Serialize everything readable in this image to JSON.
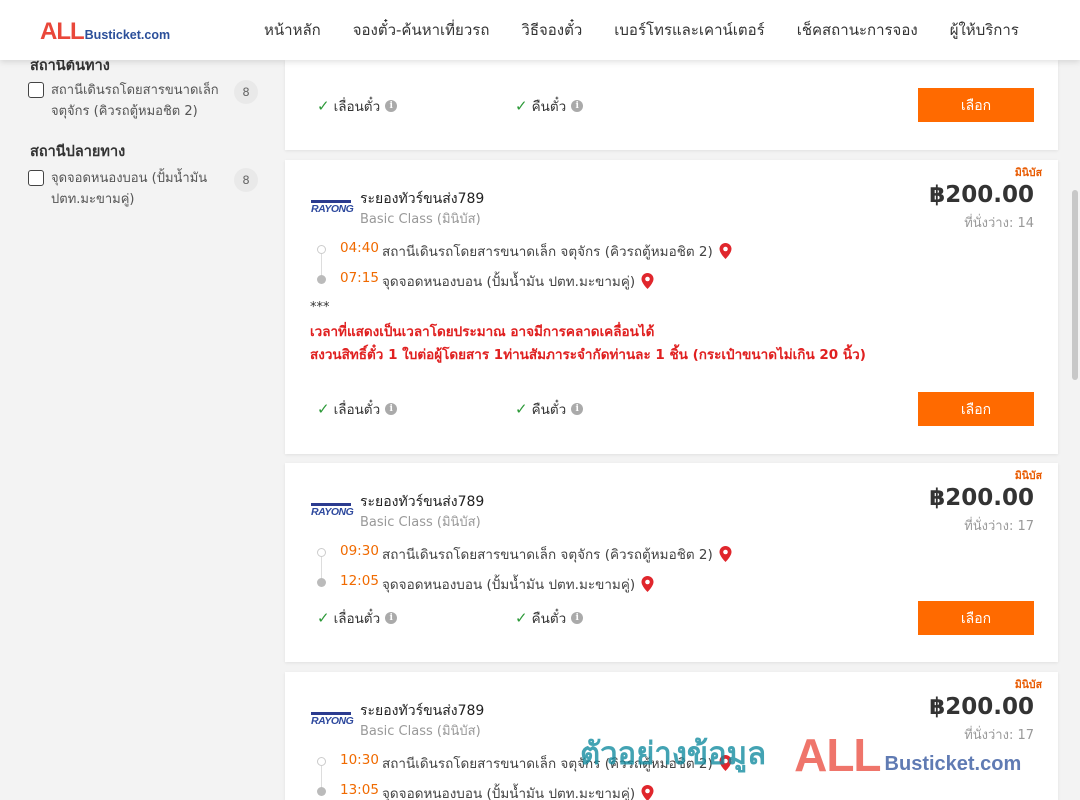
{
  "header": {
    "logo_all": "ALL",
    "logo_site": "Busticket.com",
    "nav": [
      "หน้าหลัก",
      "จองตั๋ว-ค้นหาเที่ยวรถ",
      "วิธีจองตั๋ว",
      "เบอร์โทรและเคาน์เตอร์",
      "เช็คสถานะการจอง",
      "ผู้ให้บริการ"
    ]
  },
  "sidebar": {
    "origin_title": "สถานีต้นทาง",
    "origin_filter": {
      "label": "สถานีเดินรถโดยสารขนาดเล็ก จตุจักร (คิวรถตู้หมอชิต 2)",
      "count": "8"
    },
    "dest_title": "สถานีปลายทาง",
    "dest_filter": {
      "label": "จุดจอดหนองบอน (ปั้มน้ำมัน ปตท.มะขามคู่)",
      "count": "8"
    }
  },
  "common": {
    "reschedule": "เลื่อนตั๋ว",
    "refund": "คืนตั๋ว",
    "select": "เลือก",
    "mini_tag": "มินิบัส",
    "logo_text": "RAYONG",
    "info_glyph": "i",
    "check_glyph": "✓"
  },
  "trips": [
    {
      "operator": "ระยองทัวร์ขนส่ง789",
      "class": "Basic Class (มินิบัส)",
      "price": "฿200.00",
      "seats": "ที่นั่งว่าง: 14",
      "depart_time": "04:40",
      "depart_station": "สถานีเดินรถโดยสารขนาดเล็ก จตุจักร (คิวรถตู้หมอชิต 2)",
      "arrive_time": "07:15",
      "arrive_station": "จุดจอดหนองบอน (ปั้มน้ำมัน ปตท.มะขามคู่)",
      "note_stars": "***",
      "note_line1": "เวลาที่แสดงเป็นเวลาโดยประมาณ อาจมีการคลาดเคลื่อนได้",
      "note_line2": "สงวนสิทธิ์ตั๋ว 1 ใบต่อผู้โดยสาร 1ท่านสัมภาระจำกัดท่านละ 1 ชิ้น (กระเป๋าขนาดไม่เกิน 20 นิ้ว)"
    },
    {
      "operator": "ระยองทัวร์ขนส่ง789",
      "class": "Basic Class (มินิบัส)",
      "price": "฿200.00",
      "seats": "ที่นั่งว่าง: 17",
      "depart_time": "09:30",
      "depart_station": "สถานีเดินรถโดยสารขนาดเล็ก จตุจักร (คิวรถตู้หมอชิต 2)",
      "arrive_time": "12:05",
      "arrive_station": "จุดจอดหนองบอน (ปั้มน้ำมัน ปตท.มะขามคู่)"
    },
    {
      "operator": "ระยองทัวร์ขนส่ง789",
      "class": "Basic Class (มินิบัส)",
      "price": "฿200.00",
      "seats": "ที่นั่งว่าง: 17",
      "depart_time": "10:30",
      "depart_station": "สถานีเดินรถโดยสารขนาดเล็ก จตุจักร (คิวรถตู้หมอชิต 2)",
      "arrive_time": "13:05",
      "arrive_station": "จุดจอดหนองบอน (ปั้มน้ำมัน ปตท.มะขามคู่)"
    }
  ],
  "watermark": {
    "thai": "ตัวอย่างข้อมูล",
    "all": "ALL",
    "site": "Busticket.com"
  },
  "colors": {
    "accent": "#ff6a00",
    "time": "#f06a00",
    "alert": "#e02020",
    "check": "#2e9a3a",
    "brand_red": "#e9473a",
    "brand_blue": "#2b4f9a"
  }
}
